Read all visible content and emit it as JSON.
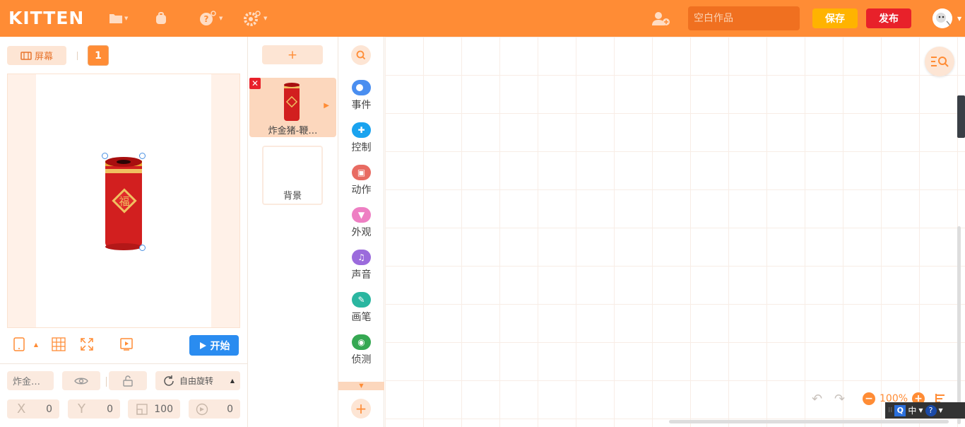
{
  "app": {
    "logo": "KITTEN"
  },
  "topbar": {
    "work_title_placeholder": "空白作品",
    "save_label": "保存",
    "publish_label": "发布"
  },
  "stage": {
    "screen_label": "屏幕",
    "page_number": "1",
    "start_label": "开始"
  },
  "sprite_props": {
    "name": "炸金…",
    "rotation_mode": "自由旋转",
    "x_label": "X",
    "x": "0",
    "y_label": "Y",
    "y": "0",
    "size": "100",
    "direction": "0"
  },
  "sprites": {
    "add_label": "+",
    "items": [
      {
        "name": "炸金猪-鞭…",
        "selected": true
      }
    ],
    "background_label": "背景"
  },
  "categories": [
    {
      "label": "事件",
      "color": "#4a8ef0",
      "icon": "event-icon"
    },
    {
      "label": "控制",
      "color": "#1aa3ef",
      "icon": "control-icon"
    },
    {
      "label": "动作",
      "color": "#e86b62",
      "icon": "motion-icon"
    },
    {
      "label": "外观",
      "color": "#ee7fc3",
      "icon": "looks-icon"
    },
    {
      "label": "声音",
      "color": "#9b6bdc",
      "icon": "sound-icon"
    },
    {
      "label": "画笔",
      "color": "#2ab6a0",
      "icon": "pen-icon"
    },
    {
      "label": "侦测",
      "color": "#35a852",
      "icon": "sensing-icon"
    }
  ],
  "workspace": {
    "zoom_label": "100%"
  },
  "ime": {
    "lang": "中"
  },
  "colors": {
    "accent": "#ff8c35",
    "save": "#ffb300",
    "publish": "#e8212a",
    "start": "#2a8cf0"
  }
}
